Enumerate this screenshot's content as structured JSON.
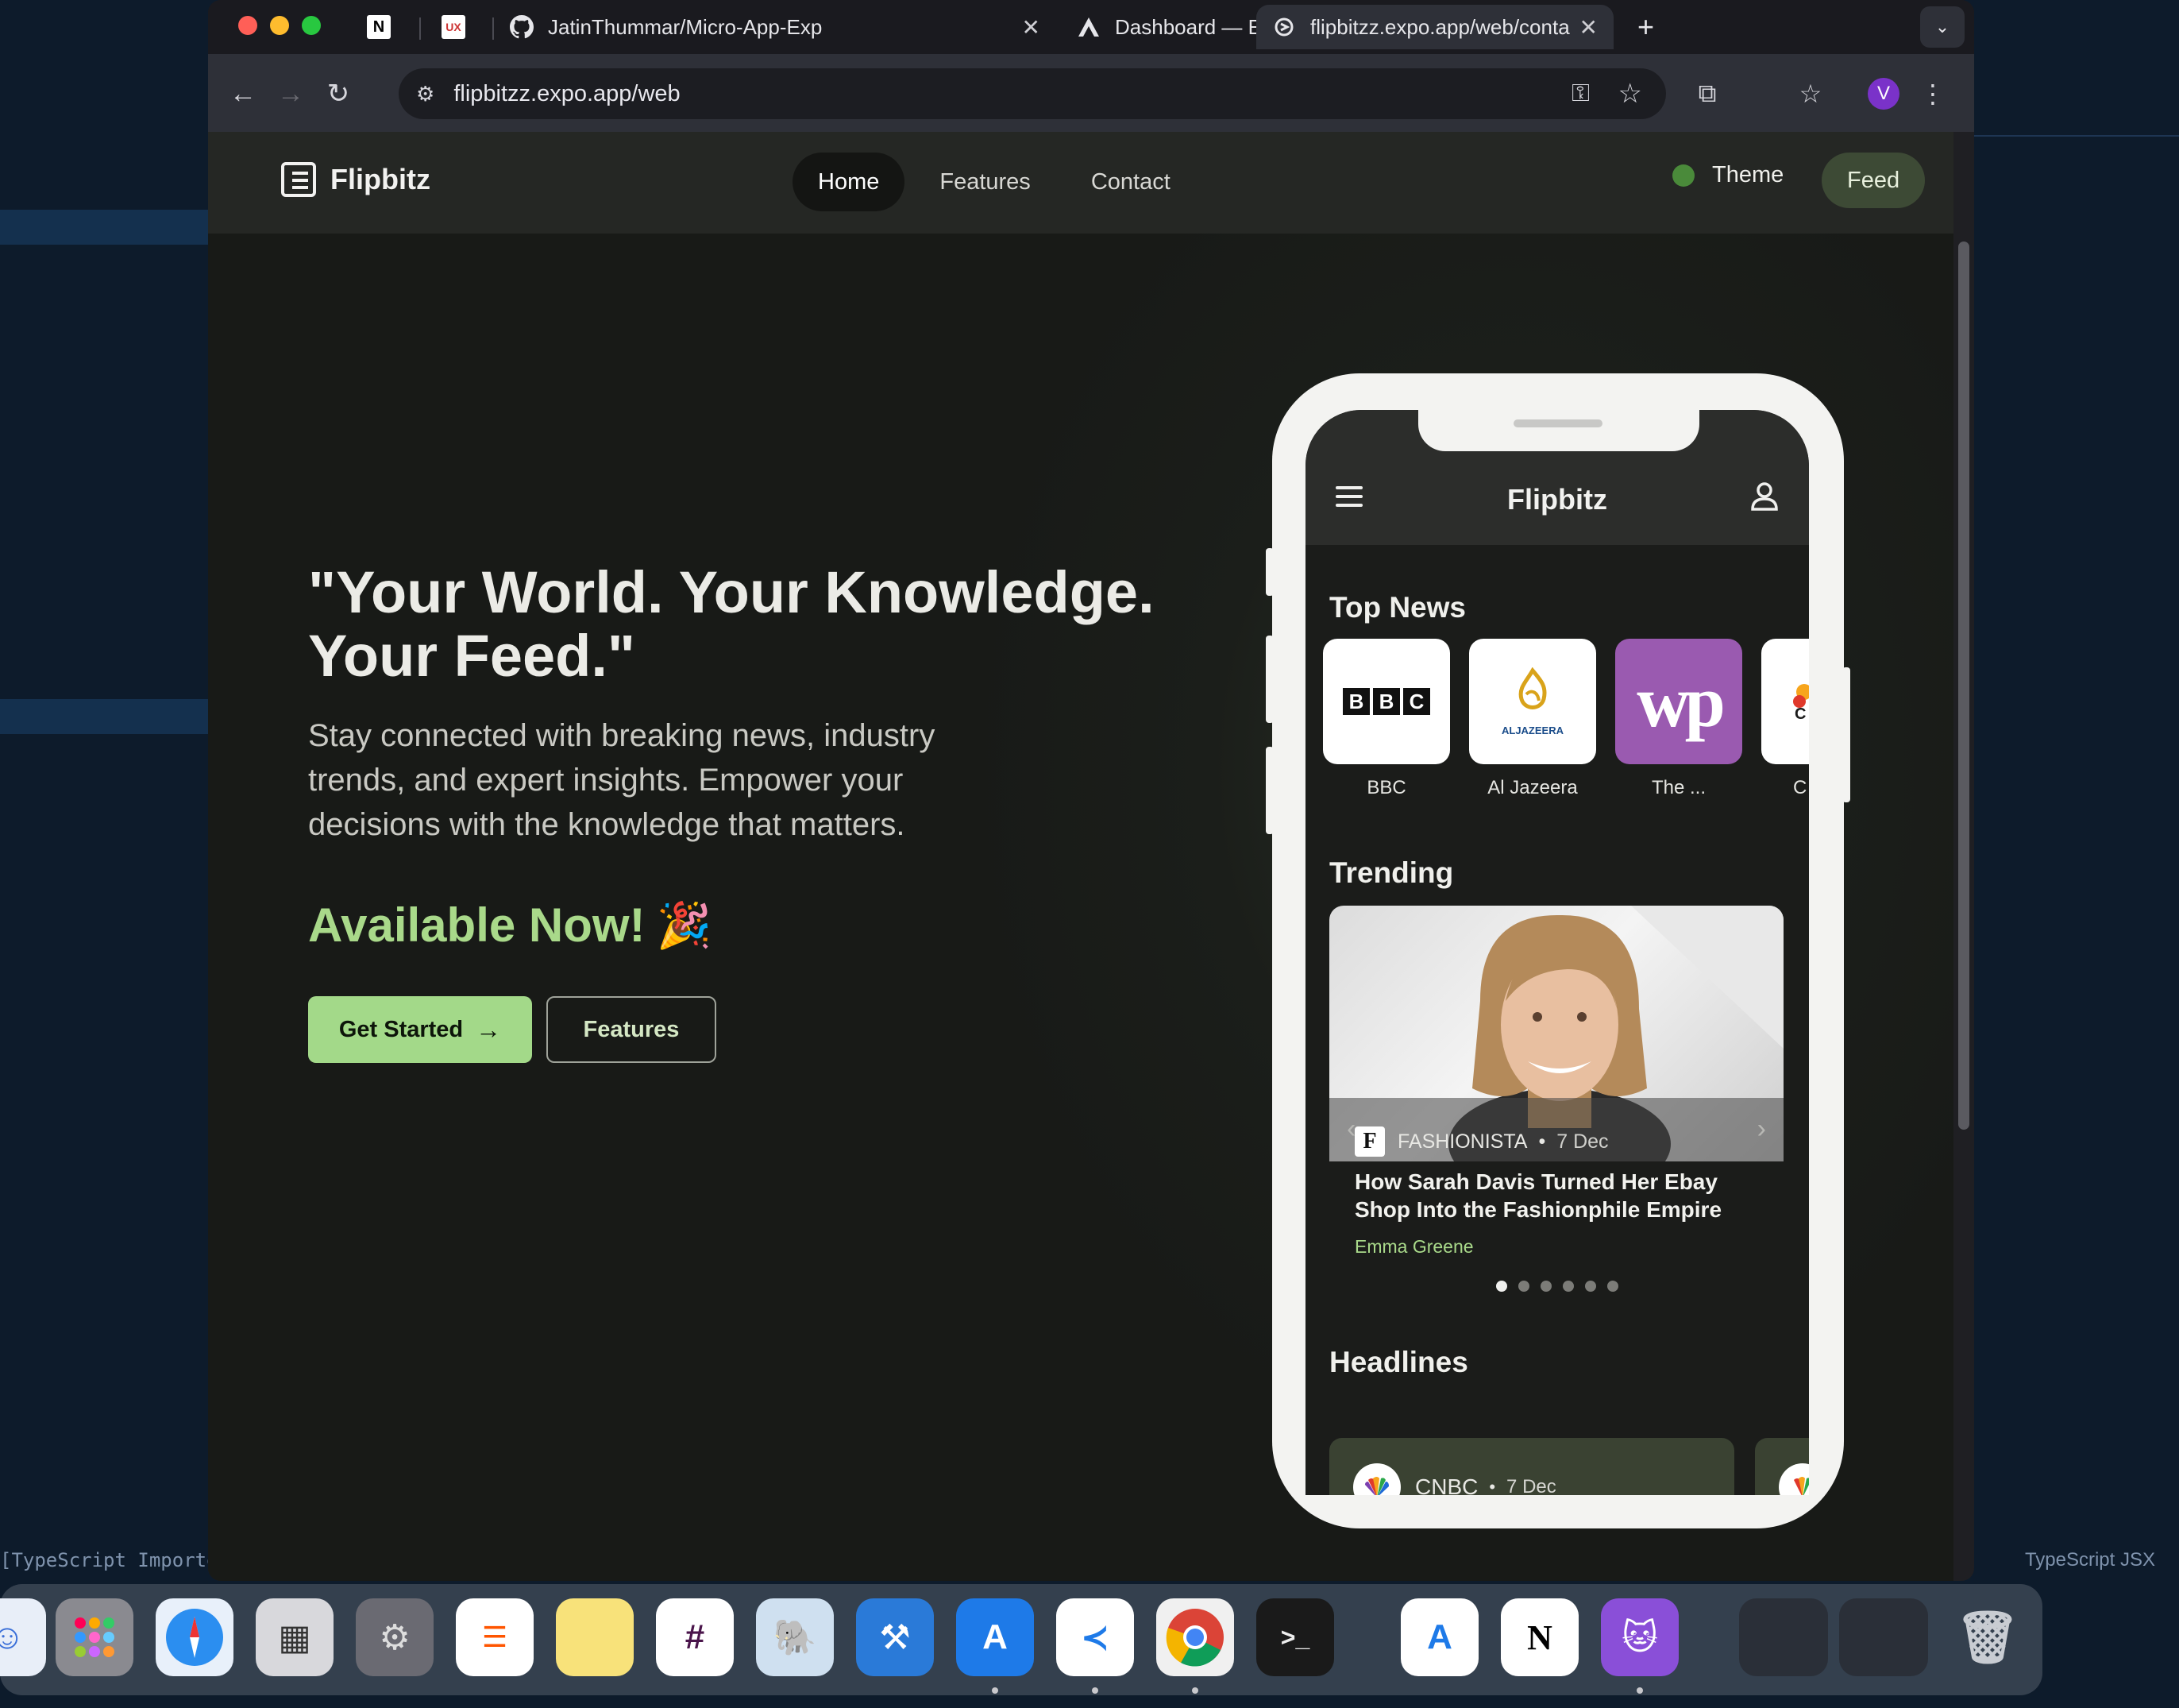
{
  "browser": {
    "tabs": [
      {
        "icon": "notion-icon",
        "label": ""
      },
      {
        "icon": "uxcel-icon",
        "label": ""
      },
      {
        "icon": "github-icon",
        "label": "JatinThummar/Micro-App-Exp"
      },
      {
        "icon": "expo-icon",
        "label": "Dashboard — Expo"
      },
      {
        "icon": "flipbitz-icon",
        "label": "flipbitzz.expo.app/web/conta"
      }
    ],
    "url": "flipbitzz.expo.app/web",
    "profile_initial": "V"
  },
  "site": {
    "brand": "Flipbitz",
    "nav": [
      "Home",
      "Features",
      "Contact"
    ],
    "active_nav": "Home",
    "theme_label": "Theme",
    "feed_label": "Feed",
    "hero_title": "\"Your World. Your Knowledge. Your Feed.\"",
    "hero_subtitle": "Stay connected with breaking news, industry trends, and expert insights. Empower your decisions with the knowledge that matters.",
    "available": "Available Now!",
    "available_emoji": "🎉",
    "cta_primary": "Get Started",
    "cta_secondary": "Features"
  },
  "phone": {
    "app_title": "Flipbitz",
    "top_news_title": "Top News",
    "sources": [
      "BBC",
      "Al Jazeera",
      "The ...",
      "C"
    ],
    "trending_title": "Trending",
    "trending": {
      "source": "FASHIONISTA",
      "date": "7 Dec",
      "headline": "How Sarah Davis Turned Her Ebay Shop Into the Fashionphile Empire",
      "author": "Emma Greene",
      "slide_count": 6,
      "active_slide": 1
    },
    "headlines_title": "Headlines",
    "headline_source": "CNBC",
    "headline_date": "7 Dec"
  },
  "background": {
    "status_left": "[TypeScript Importer]: Sy",
    "status_right": "TypeScript JSX"
  },
  "colors": {
    "accent_green": "#a3d989",
    "dark_bg": "#1b1e1a"
  }
}
